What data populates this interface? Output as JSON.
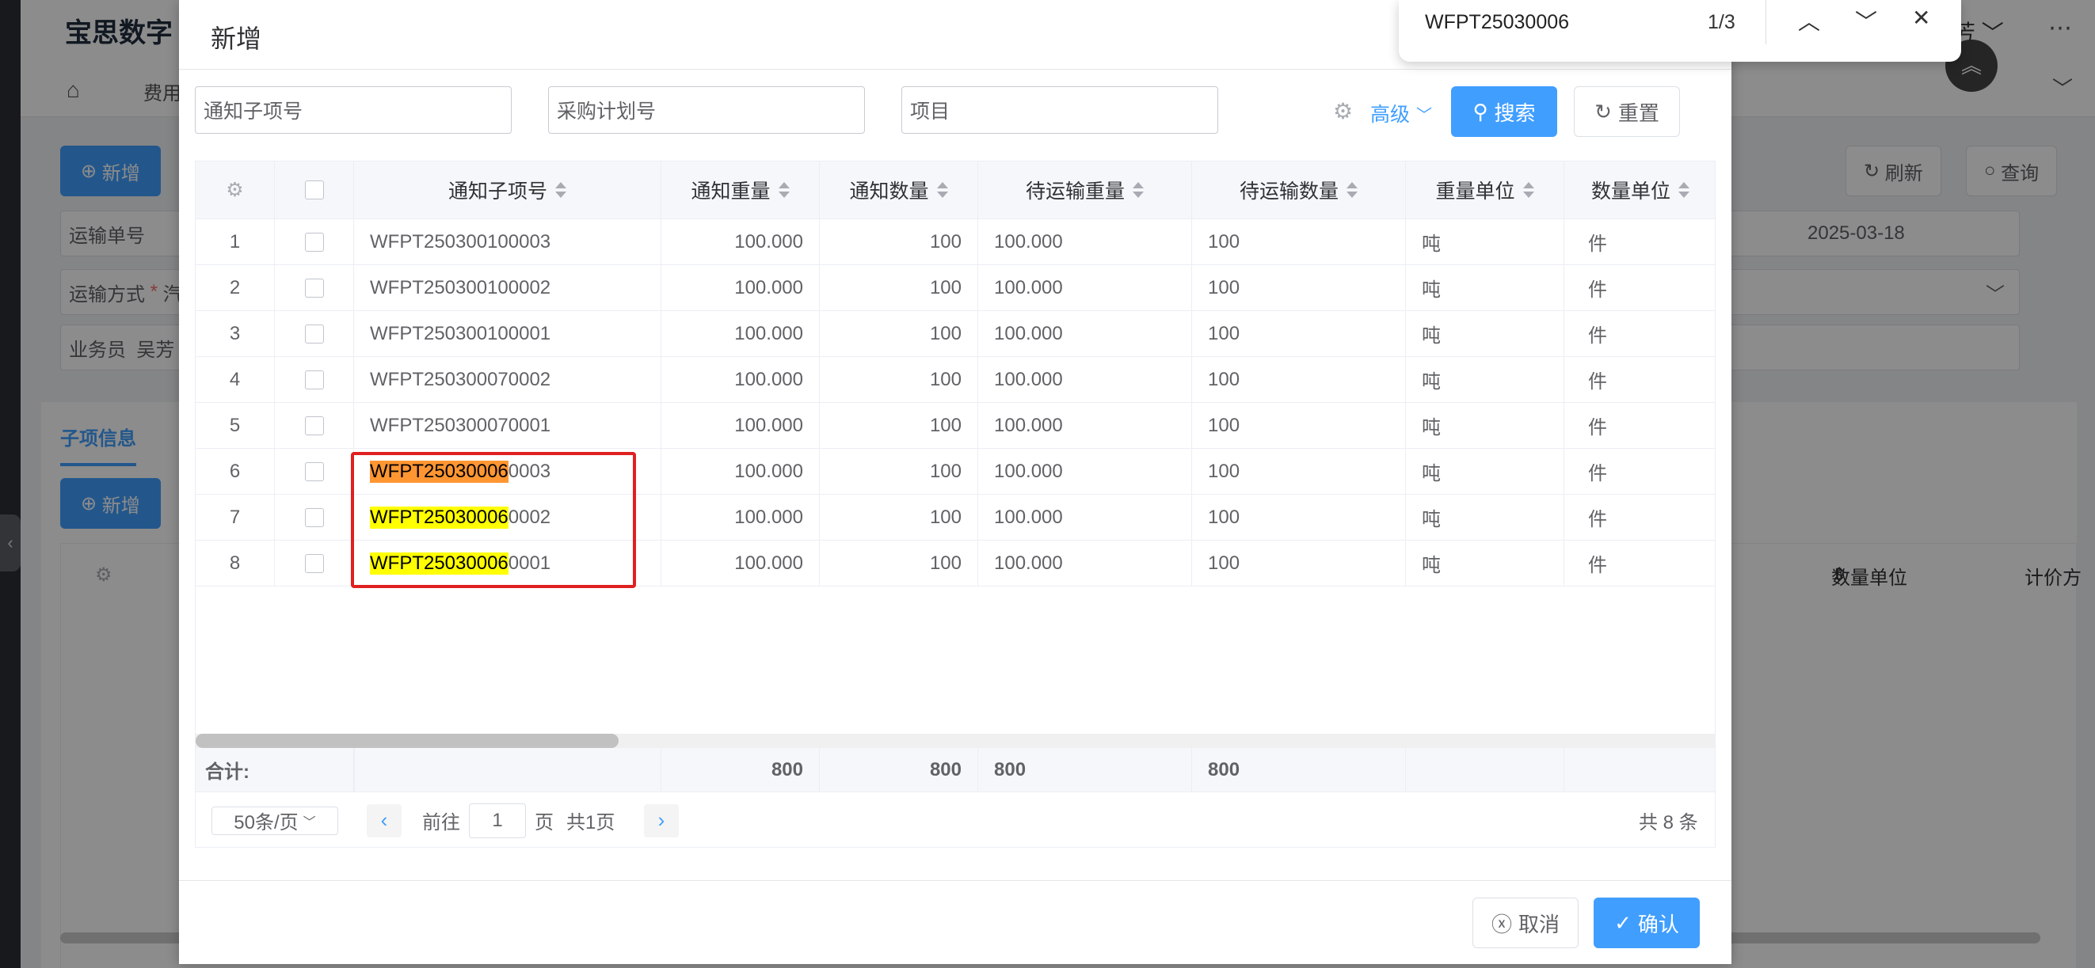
{
  "background": {
    "brand": "宝思数字",
    "user_fragment": "芳",
    "tab_fee": "费用",
    "add_label": "新增",
    "refresh_label": "刷新",
    "query_label": "查询",
    "field_transport_no": "运输单号",
    "field_transport_mode": "运输方式",
    "field_mode_value": "汽",
    "field_salesman": "业务员",
    "field_salesman_value": "吴芳",
    "date_value": "2025-03-18",
    "sub_tab": "子项信息",
    "sub_add_label": "新增",
    "col_qty_unit": "数量单位",
    "col_price_fragment": "计价方"
  },
  "dialog": {
    "title": "新增",
    "filters": {
      "notice_sub_no": "通知子项号",
      "purchase_plan_no": "采购计划号",
      "project": "项目"
    },
    "advanced_label": "高级",
    "search_label": "搜索",
    "reset_label": "重置",
    "columns": [
      "通知子项号",
      "通知重量",
      "通知数量",
      "待运输重量",
      "待运输数量",
      "重量单位",
      "数量单位"
    ],
    "rows": [
      {
        "idx": "1",
        "no": "WFPT250300100003",
        "w": "100.000",
        "q": "100",
        "pw": "100.000",
        "pq": "100",
        "wu": "吨",
        "qu": "件"
      },
      {
        "idx": "2",
        "no": "WFPT250300100002",
        "w": "100.000",
        "q": "100",
        "pw": "100.000",
        "pq": "100",
        "wu": "吨",
        "qu": "件"
      },
      {
        "idx": "3",
        "no": "WFPT250300100001",
        "w": "100.000",
        "q": "100",
        "pw": "100.000",
        "pq": "100",
        "wu": "吨",
        "qu": "件"
      },
      {
        "idx": "4",
        "no": "WFPT250300070002",
        "w": "100.000",
        "q": "100",
        "pw": "100.000",
        "pq": "100",
        "wu": "吨",
        "qu": "件"
      },
      {
        "idx": "5",
        "no": "WFPT250300070001",
        "w": "100.000",
        "q": "100",
        "pw": "100.000",
        "pq": "100",
        "wu": "吨",
        "qu": "件"
      },
      {
        "idx": "6",
        "no_match": "WFPT25030006",
        "no_rest": "0003",
        "w": "100.000",
        "q": "100",
        "pw": "100.000",
        "pq": "100",
        "wu": "吨",
        "qu": "件"
      },
      {
        "idx": "7",
        "no_match": "WFPT25030006",
        "no_rest": "0002",
        "w": "100.000",
        "q": "100",
        "pw": "100.000",
        "pq": "100",
        "wu": "吨",
        "qu": "件"
      },
      {
        "idx": "8",
        "no_match": "WFPT25030006",
        "no_rest": "0001",
        "w": "100.000",
        "q": "100",
        "pw": "100.000",
        "pq": "100",
        "wu": "吨",
        "qu": "件"
      }
    ],
    "summary": {
      "label": "合计:",
      "w": "800",
      "q": "800",
      "pw": "800",
      "pq": "800"
    },
    "pager": {
      "page_size": "50条/页",
      "goto_label": "前往",
      "page_value": "1",
      "page_unit": "页",
      "total_pages": "共1页",
      "total": "共 8 条"
    },
    "cancel_label": "取消",
    "confirm_label": "确认"
  },
  "findbar": {
    "query": "WFPT25030006",
    "count": "1/3"
  }
}
